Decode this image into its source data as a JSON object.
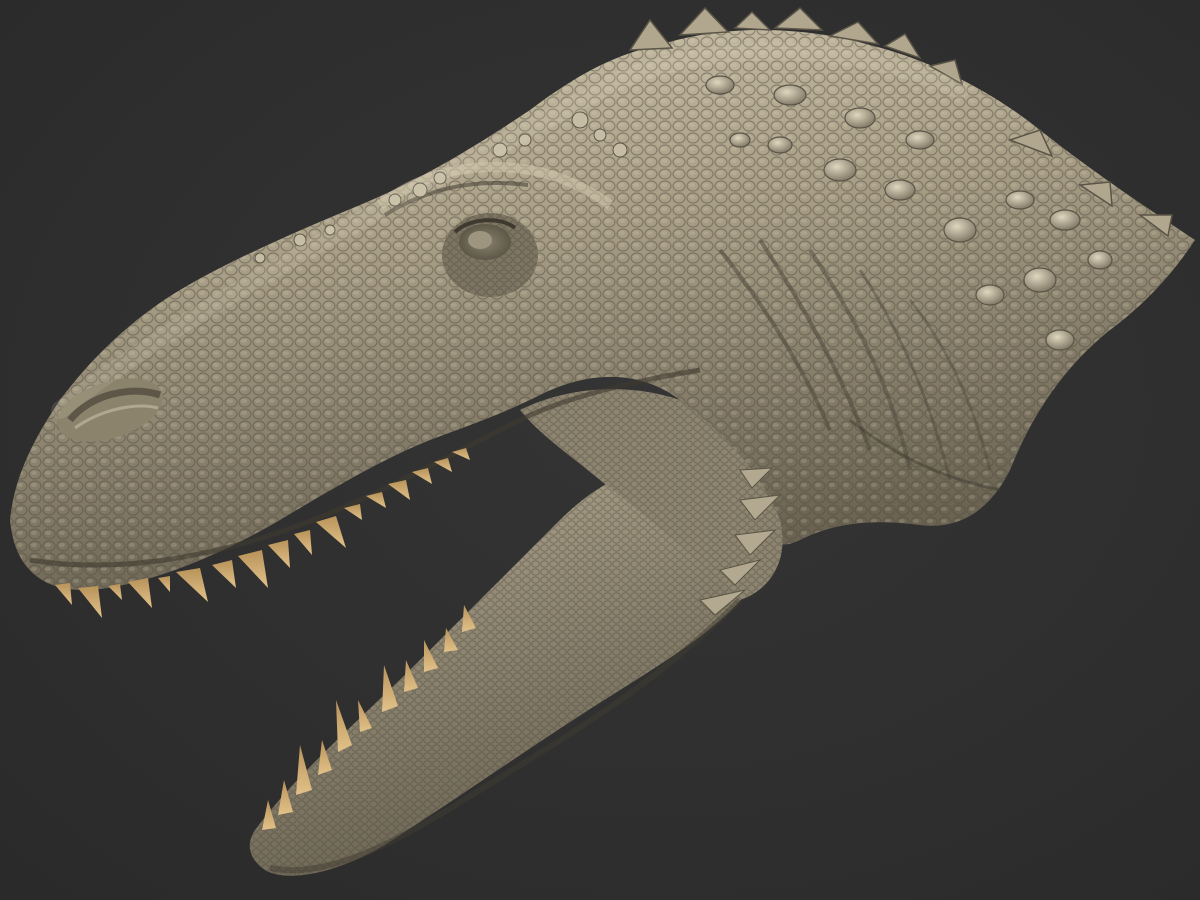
{
  "scene": {
    "subject": "",
    "colors": {
      "background": "#2e2e2e",
      "skin_light": "#c2b8a0",
      "skin_mid": "#9a907a",
      "skin_dark": "#5a5446",
      "teeth": "#d6b27a",
      "mouth_cavity": "#2e2e2e"
    }
  }
}
